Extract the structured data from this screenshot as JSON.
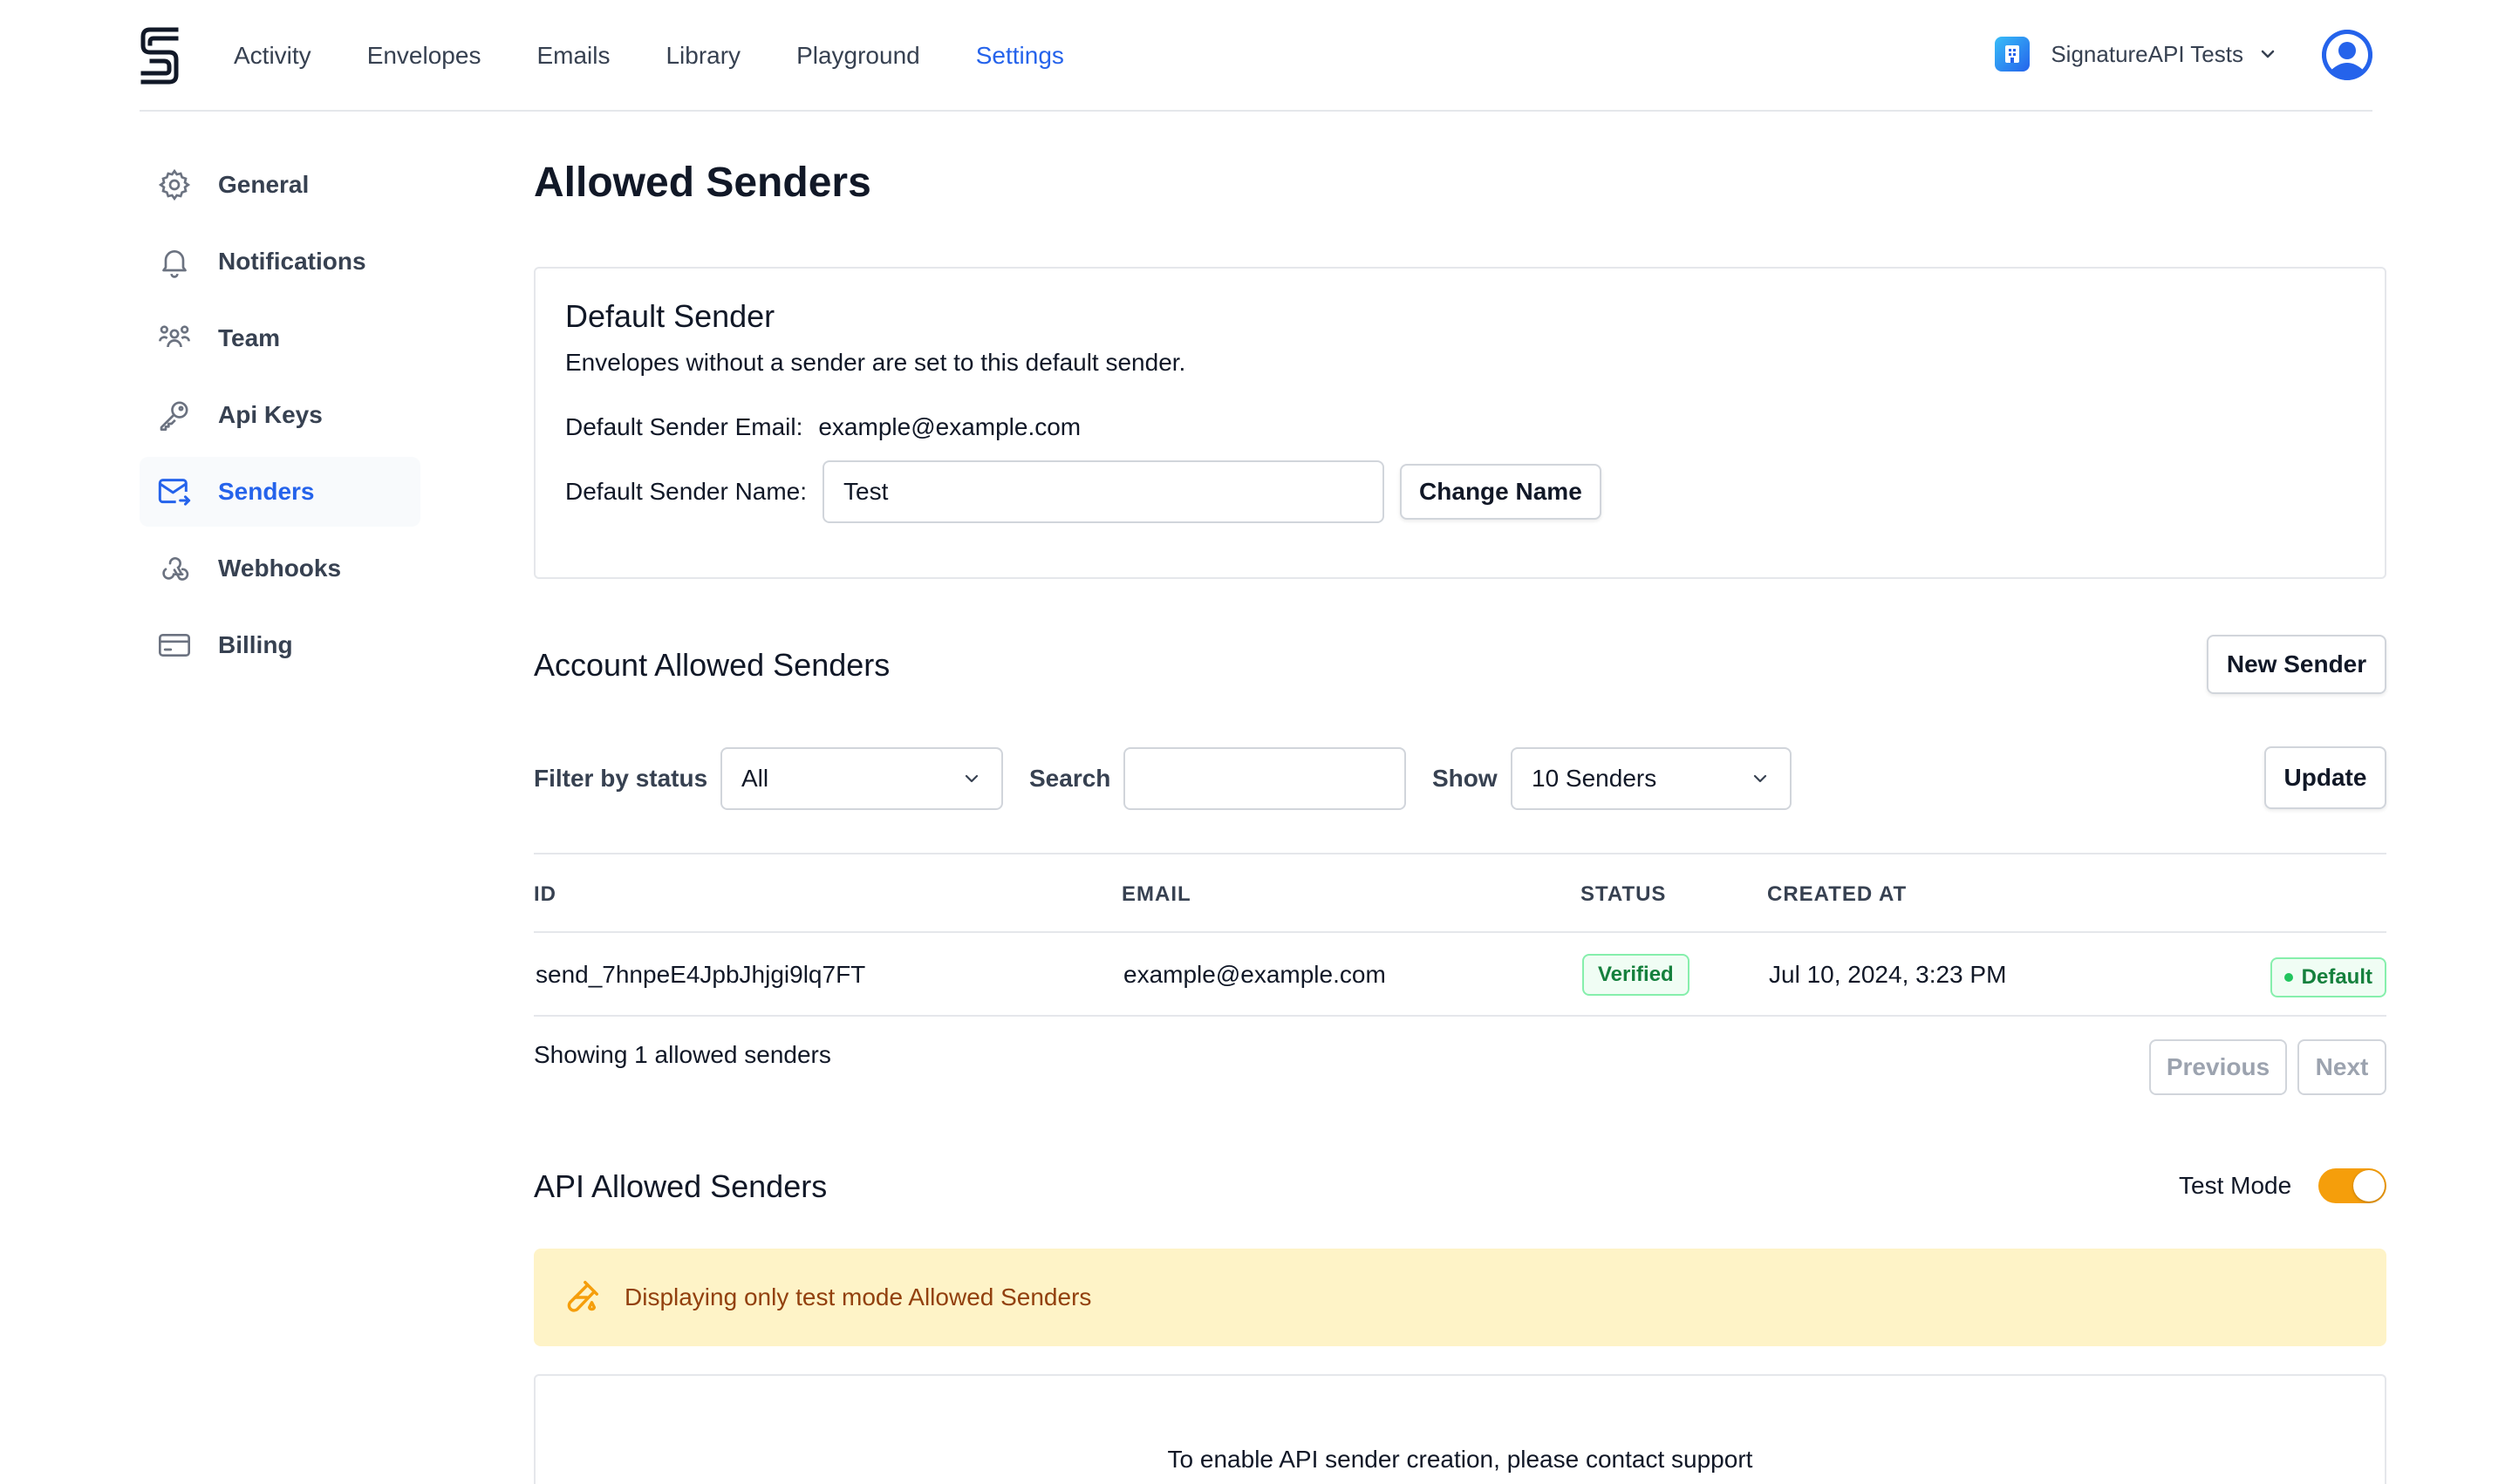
{
  "header": {
    "nav": [
      "Activity",
      "Envelopes",
      "Emails",
      "Library",
      "Playground",
      "Settings"
    ],
    "active_nav": "Settings",
    "org_name": "SignatureAPI Tests",
    "logo_icon": "signatureapi-logo-icon",
    "accent_color": "#2563eb"
  },
  "sidebar": {
    "items": [
      {
        "label": "General",
        "icon": "gear-icon"
      },
      {
        "label": "Notifications",
        "icon": "bell-icon"
      },
      {
        "label": "Team",
        "icon": "team-icon"
      },
      {
        "label": "Api Keys",
        "icon": "key-icon"
      },
      {
        "label": "Senders",
        "icon": "mail-icon"
      },
      {
        "label": "Webhooks",
        "icon": "webhook-icon"
      },
      {
        "label": "Billing",
        "icon": "credit-card-icon"
      }
    ],
    "active": "Senders"
  },
  "main": {
    "title": "Allowed Senders",
    "default_sender": {
      "title": "Default Sender",
      "subtitle": "Envelopes without a sender are set to this default sender.",
      "email_label": "Default Sender Email:",
      "email_value": "example@example.com",
      "name_label": "Default Sender Name:",
      "name_value": "Test",
      "change_name_button": "Change Name"
    },
    "account_senders": {
      "title": "Account Allowed Senders",
      "new_sender_button": "New Sender",
      "filter_label": "Filter by status",
      "filter_value": "All",
      "search_label": "Search",
      "search_value": "",
      "show_label": "Show",
      "show_value": "10 Senders",
      "update_button": "Update",
      "columns": [
        "ID",
        "EMAIL",
        "STATUS",
        "CREATED AT"
      ],
      "rows": [
        {
          "id": "send_7hnpeE4JpbJhjgi9lq7FT",
          "email": "example@example.com",
          "status": "Verified",
          "created_at": "Jul 10, 2024, 3:23 PM",
          "tag": "Default"
        }
      ],
      "showing_text": "Showing 1 allowed senders",
      "previous_button": "Previous",
      "next_button": "Next"
    },
    "api_senders": {
      "title": "API Allowed Senders",
      "test_mode_label": "Test Mode",
      "test_mode_on": true,
      "toggle_color": "#f59e0b",
      "banner_text": "Displaying only test mode Allowed Senders",
      "banner_color": "#fef3c7",
      "empty_text": "To enable API sender creation, please contact support"
    }
  }
}
